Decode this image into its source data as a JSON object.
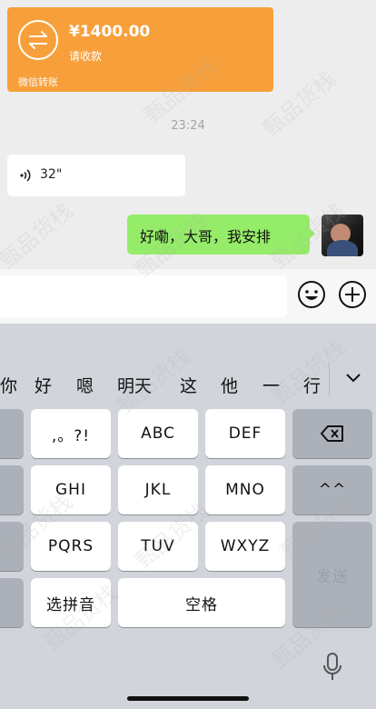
{
  "transfer": {
    "amount": "¥1400.00",
    "subtitle": "请收款",
    "footer": "微信转账",
    "color": "#f7a03b"
  },
  "time_label": "23:24",
  "voice": {
    "duration": "32\""
  },
  "outgoing_message": {
    "text": "好嘞，大哥，我安排",
    "color": "#95ec69"
  },
  "input_bar": {
    "value": ""
  },
  "keyboard": {
    "candidates": [
      "你",
      "好",
      "嗯",
      "明天",
      "这",
      "他",
      "一",
      "行"
    ],
    "row1": [
      ",。?!",
      "ABC",
      "DEF"
    ],
    "row2": [
      "GHI",
      "JKL",
      "MNO"
    ],
    "row3": [
      "PQRS",
      "TUV",
      "WXYZ"
    ],
    "pinyin_key": "选拼音",
    "space_key": "空格",
    "send_key": "发送",
    "caret_key": "^^"
  },
  "watermark": "甄品货栈"
}
